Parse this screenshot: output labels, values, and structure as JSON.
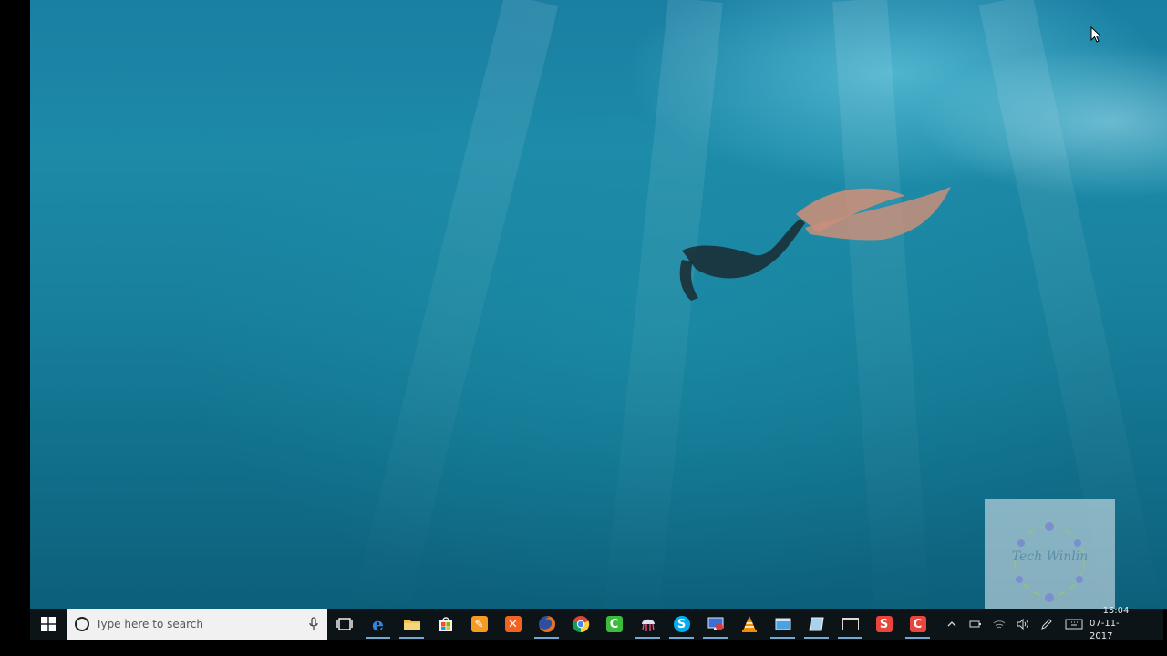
{
  "taskbar": {
    "search_placeholder": "Type here to search",
    "pinned_apps": [
      {
        "name": "task-view",
        "active": false
      },
      {
        "name": "edge",
        "glyph": "e",
        "color": "#1e73d0",
        "active": true
      },
      {
        "name": "file-explorer",
        "color": "#f2c14e",
        "active": true
      },
      {
        "name": "store",
        "color": "#1f8fe0",
        "active": false
      },
      {
        "name": "app-orange",
        "color": "#f28a1e",
        "active": false
      },
      {
        "name": "xampp",
        "color": "#f26322",
        "active": false
      },
      {
        "name": "firefox",
        "color": "#e86a17",
        "active": true
      },
      {
        "name": "chrome",
        "color": "#34a853",
        "active": false
      },
      {
        "name": "camtasia",
        "color": "#3dbb3d",
        "active": false
      },
      {
        "name": "app-jellyfish",
        "color": "#d8d8e8",
        "active": true
      },
      {
        "name": "skype",
        "glyph": "S",
        "color": "#00aff0",
        "active": true
      },
      {
        "name": "remote-desktop",
        "color": "#3b6fd1",
        "active": true
      },
      {
        "name": "vlc",
        "color": "#f28c00",
        "active": false
      },
      {
        "name": "app-window",
        "color": "#4aa3e0",
        "active": true
      },
      {
        "name": "app-paper",
        "color": "#9ec9e8",
        "active": true
      },
      {
        "name": "command-prompt",
        "color": "#1e1e1e",
        "active": true
      },
      {
        "name": "sublime-text",
        "glyph": "S",
        "color": "#e8453c",
        "active": false
      },
      {
        "name": "app-c",
        "glyph": "C",
        "color": "#e8453c",
        "active": true
      }
    ]
  },
  "tray": {
    "time": "15:04",
    "date": "07-11-2017"
  },
  "watermark": {
    "text": "Tech Winlin"
  }
}
